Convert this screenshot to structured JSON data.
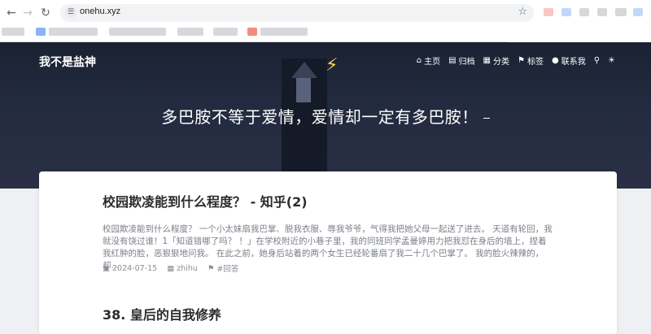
{
  "browser": {
    "url": "onehu.xyz",
    "back_icon": "arrow-left-icon",
    "forward_icon": "arrow-right-icon",
    "reload_icon": "reload-icon"
  },
  "site": {
    "brand": "我不是盐神",
    "menu": [
      {
        "icon": "home-icon",
        "label": "主页"
      },
      {
        "icon": "archive-icon",
        "label": "归档"
      },
      {
        "icon": "category-icon",
        "label": "分类"
      },
      {
        "icon": "tag-icon",
        "label": "标签"
      },
      {
        "icon": "user-icon",
        "label": "联系我"
      }
    ],
    "headline": "多巴胺不等于爱情，爱情却一定有多巴胺！"
  },
  "posts": [
    {
      "title": "校园欺凌能到什么程度？ - 知乎(2)",
      "excerpt": "校园欺凌能到什么程度？ 一个小太妹扇我巴掌、脱我衣服、辱我爷爷，气得我把她父母一起送了进去。 天道有轮回，我就没有饶过谁！1「知道错哪了吗？ ！」在学校附近的小巷子里，我的同班同学孟曼婷用力把我怼在身后的墙上，捏着我红肿的脸，恶狠狠地问我。 在此之前，她身后站着的两个女生已经轮番扇了我二十几个巴掌了。 我的脸火辣辣的，却...",
      "date": "2024-07-15",
      "category": "zhihu",
      "tag": "#回答"
    },
    {
      "title": "38. 皇后的自我修养"
    }
  ]
}
